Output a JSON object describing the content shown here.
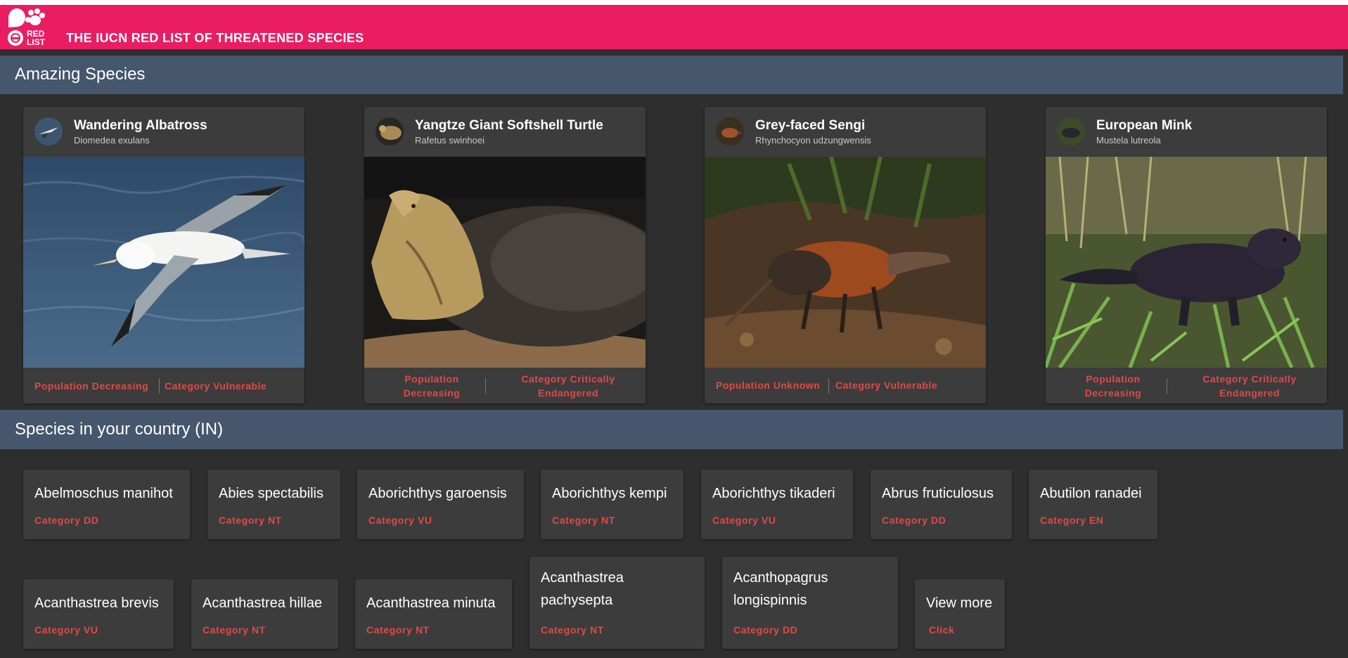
{
  "header": {
    "title": "THE IUCN RED LIST OF THREATENED SPECIES",
    "logo_text": "RED LIST",
    "brand_color": "#ea1d63"
  },
  "amazing": {
    "title": "Amazing Species",
    "cards": [
      {
        "name": "Wandering Albatross",
        "scientific": "Diomedea exulans",
        "population": "Population Decreasing",
        "category": "Category Vulnerable"
      },
      {
        "name": "Yangtze Giant Softshell Turtle",
        "scientific": "Rafetus swinhoei",
        "population": "Population Decreasing",
        "category": "Category Critically Endangered"
      },
      {
        "name": "Grey-faced Sengi",
        "scientific": "Rhynchocyon udzungwensis",
        "population": "Population Unknown",
        "category": "Category Vulnerable"
      },
      {
        "name": "European Mink",
        "scientific": "Mustela lutreola",
        "population": "Population Decreasing",
        "category": "Category Critically Endangered"
      }
    ]
  },
  "country": {
    "title": "Species in your country (IN)",
    "tiles": [
      {
        "name": "Abelmoschus manihot",
        "category": "Category DD"
      },
      {
        "name": "Abies spectabilis",
        "category": "Category NT"
      },
      {
        "name": "Aborichthys garoensis",
        "category": "Category VU"
      },
      {
        "name": "Aborichthys kempi",
        "category": "Category NT"
      },
      {
        "name": "Aborichthys tikaderi",
        "category": "Category VU"
      },
      {
        "name": "Abrus fruticulosus",
        "category": "Category DD"
      },
      {
        "name": "Abutilon ranadei",
        "category": "Category EN"
      },
      {
        "name": "Acanthastrea brevis",
        "category": "Category VU"
      },
      {
        "name": "Acanthastrea hillae",
        "category": "Category NT"
      },
      {
        "name": "Acanthastrea minuta",
        "category": "Category NT"
      },
      {
        "name": "Acanthastrea pachysepta",
        "category": "Category NT"
      },
      {
        "name": "Acanthopagrus longispinnis",
        "category": "Category DD"
      }
    ],
    "view_more": {
      "label": "View more",
      "action": "Click"
    }
  }
}
